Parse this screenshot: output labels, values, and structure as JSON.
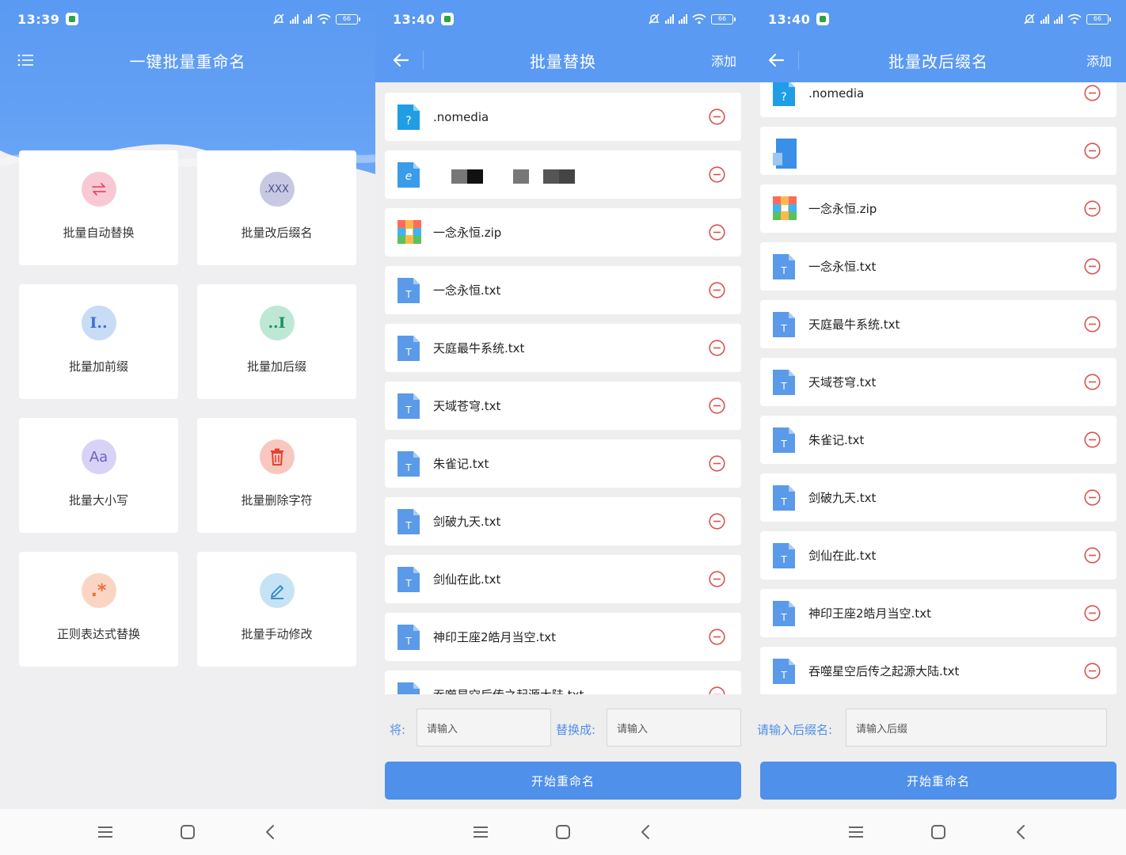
{
  "colors": {
    "primary": "#5a9af2",
    "accent_red": "#d9534f",
    "button": "#4f90ea"
  },
  "screen1": {
    "status": {
      "time": "13:39",
      "battery": "66"
    },
    "title": "一键批量重命名",
    "menu_icon": "list-menu-icon",
    "cards": [
      {
        "label": "批量自动替换",
        "icon": "swap-arrows-icon",
        "icon_text": "",
        "bg": "#f9c9d3",
        "fg": "#e8496b"
      },
      {
        "label": "批量改后缀名",
        "icon": "suffix-xxx-icon",
        "icon_text": ".XXX",
        "bg": "#c7c9e3",
        "fg": "#4a4f86"
      },
      {
        "label": "批量加前缀",
        "icon": "prefix-icon",
        "icon_text": "I..",
        "bg": "#c9dcf6",
        "fg": "#3e6fd0"
      },
      {
        "label": "批量加后缀",
        "icon": "suffix-icon",
        "icon_text": "..I",
        "bg": "#bfe7d6",
        "fg": "#1c9160"
      },
      {
        "label": "批量大小写",
        "icon": "case-aa-icon",
        "icon_text": "Aa",
        "bg": "#d8d3f6",
        "fg": "#6c5fd0"
      },
      {
        "label": "批量删除字符",
        "icon": "trash-icon",
        "icon_text": "",
        "bg": "#f8c8c0",
        "fg": "#e2432f"
      },
      {
        "label": "正则表达式替换",
        "icon": "regex-asterisk-icon",
        "icon_text": ".*",
        "bg": "#fbd5c4",
        "fg": "#e8703d"
      },
      {
        "label": "批量手动修改",
        "icon": "pencil-icon",
        "icon_text": "",
        "bg": "#c6e3f5",
        "fg": "#2c86c9"
      }
    ]
  },
  "screen2": {
    "status": {
      "time": "13:40",
      "battery": "66"
    },
    "title": "批量替换",
    "add_label": "添加",
    "files": [
      {
        "name": ".nomedia",
        "type": "unknown"
      },
      {
        "name": "",
        "type": "html"
      },
      {
        "name": "一念永恒.zip",
        "type": "zip"
      },
      {
        "name": "一念永恒.txt",
        "type": "txt"
      },
      {
        "name": "天庭最牛系统.txt",
        "type": "txt"
      },
      {
        "name": "天域苍穹.txt",
        "type": "txt"
      },
      {
        "name": "朱雀记.txt",
        "type": "txt"
      },
      {
        "name": "剑破九天.txt",
        "type": "txt"
      },
      {
        "name": "剑仙在此.txt",
        "type": "txt"
      },
      {
        "name": "神印王座2皓月当空.txt",
        "type": "txt"
      },
      {
        "name": "吞噬星空后传之起源大陆.txt",
        "type": "txt"
      }
    ],
    "from_label": "将:",
    "from_placeholder": "请输入",
    "to_label": "替换成:",
    "to_placeholder": "请输入",
    "start_label": "开始重命名"
  },
  "screen3": {
    "status": {
      "time": "13:40",
      "battery": "66"
    },
    "title": "批量改后缀名",
    "add_label": "添加",
    "files": [
      {
        "name": ".nomedia",
        "type": "unknown"
      },
      {
        "name": "",
        "type": "folder"
      },
      {
        "name": "一念永恒.zip",
        "type": "zip"
      },
      {
        "name": "一念永恒.txt",
        "type": "txt"
      },
      {
        "name": "天庭最牛系统.txt",
        "type": "txt"
      },
      {
        "name": "天域苍穹.txt",
        "type": "txt"
      },
      {
        "name": "朱雀记.txt",
        "type": "txt"
      },
      {
        "name": "剑破九天.txt",
        "type": "txt"
      },
      {
        "name": "剑仙在此.txt",
        "type": "txt"
      },
      {
        "name": "神印王座2皓月当空.txt",
        "type": "txt"
      },
      {
        "name": "吞噬星空后传之起源大陆.txt",
        "type": "txt"
      }
    ],
    "suffix_label": "请输入后缀名:",
    "suffix_placeholder": "请输入后缀",
    "start_label": "开始重命名"
  },
  "nav": {
    "menu": "nav-menu-icon",
    "home": "nav-home-icon",
    "back": "nav-back-icon"
  }
}
